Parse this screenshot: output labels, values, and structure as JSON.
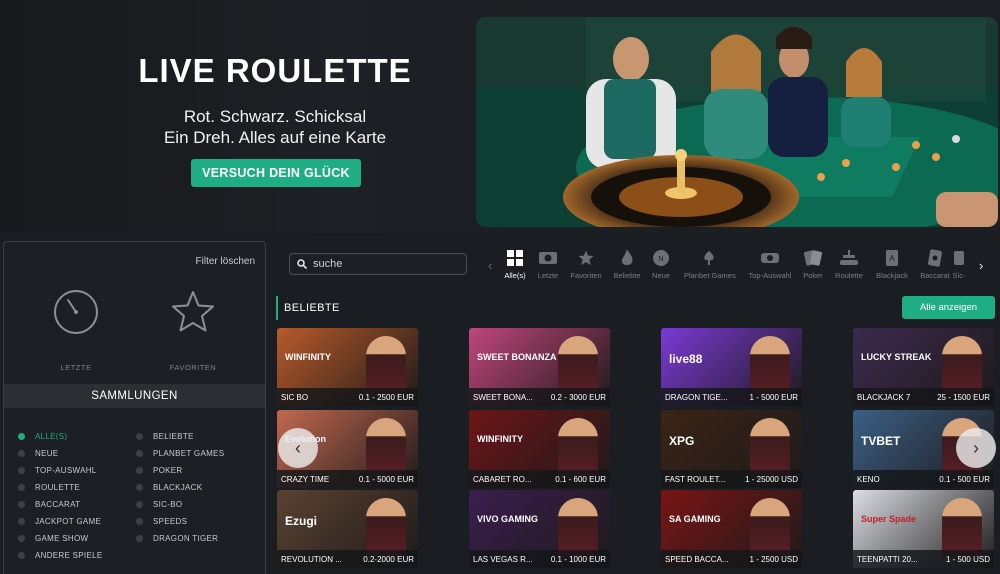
{
  "hero": {
    "title": "LIVE ROULETTE",
    "subtitle_line1": "Rot. Schwarz. Schicksal",
    "subtitle_line2": "Ein Dreh. Alles auf eine Karte",
    "cta_label": "VERSUCH DEIN GLÜCK"
  },
  "sidebar": {
    "filter_clear": "Filter löschen",
    "recent_label": "LETZTE",
    "favorites_label": "FAVORITEN",
    "collections_title": "SAMMLUNGEN",
    "collections": [
      {
        "label": "ALLE(S)",
        "active": true
      },
      {
        "label": "NEUE"
      },
      {
        "label": "TOP-AUSWAHL"
      },
      {
        "label": "ROULETTE"
      },
      {
        "label": "BACCARAT"
      },
      {
        "label": "JACKPOT GAME"
      },
      {
        "label": "GAME SHOW"
      },
      {
        "label": "ANDERE SPIELE"
      },
      {
        "label": "BELIEBTE"
      },
      {
        "label": "PLANBET GAMES"
      },
      {
        "label": "POKER"
      },
      {
        "label": "BLACKJACK"
      },
      {
        "label": "SIC-BO"
      },
      {
        "label": "SPEEDS"
      },
      {
        "label": "DRAGON TIGER"
      }
    ]
  },
  "search": {
    "placeholder": "suche"
  },
  "categories": [
    {
      "label": "Alle(s)",
      "icon": "grid-icon",
      "active": true
    },
    {
      "label": "Letzte",
      "icon": "recent-icon"
    },
    {
      "label": "Favoriten",
      "icon": "star-icon"
    },
    {
      "label": "Beliebte",
      "icon": "fire-icon"
    },
    {
      "label": "Neue",
      "icon": "badge-icon"
    },
    {
      "label": "Planbet Games",
      "icon": "cards-icon"
    },
    {
      "label": "Top-Auswahl",
      "icon": "chips-icon"
    },
    {
      "label": "Poker",
      "icon": "poker-icon"
    },
    {
      "label": "Roulette",
      "icon": "roulette-icon"
    },
    {
      "label": "Blackjack",
      "icon": "blackjack-icon"
    },
    {
      "label": "Baccarat",
      "icon": "baccarat-icon"
    },
    {
      "label": "Sic-",
      "icon": "dice-icon"
    }
  ],
  "section": {
    "title": "BELIEBTE",
    "show_all": "Alle anzeigen"
  },
  "games": [
    {
      "name": "SIC BO",
      "limit": "0.1 - 2500 EUR",
      "logo": "WINFINITY",
      "bg": "#b85a2a"
    },
    {
      "name": "SWEET BONA...",
      "limit": "0.2 - 3000 EUR",
      "logo": "SWEET BONANZA",
      "bg": "#c0467c"
    },
    {
      "name": "DRAGON TIGE...",
      "limit": "1 - 5000 EUR",
      "logo": "live88",
      "bg": "#7a3ad6"
    },
    {
      "name": "BLACKJACK 7",
      "limit": "25 - 1500 EUR",
      "logo": "LUCKY STREAK",
      "bg": "#3b2a4e"
    },
    {
      "name": "CRAZY TIME",
      "limit": "0.1 - 5000 EUR",
      "logo": "Evolution",
      "bg": "#c2684f"
    },
    {
      "name": "CABARET RO...",
      "limit": "0.1 - 600 EUR",
      "logo": "WINFINITY",
      "bg": "#6d1418"
    },
    {
      "name": "FAST ROULET...",
      "limit": "1 - 25000 USD",
      "logo": "XPG",
      "bg": "#3a2416"
    },
    {
      "name": "KENO",
      "limit": "0.1 - 500 EUR",
      "logo": "TVBET",
      "bg": "#3b5f86"
    },
    {
      "name": "REVOLUTION ...",
      "limit": "0.2-2000 EUR",
      "logo": "Ezugi",
      "bg": "#5a4232"
    },
    {
      "name": "LAS VEGAS R...",
      "limit": "0.1 - 1000 EUR",
      "logo": "VIVO GAMING",
      "bg": "#3a1e4e"
    },
    {
      "name": "SPEED BACCA...",
      "limit": "1 - 2500 USD",
      "logo": "SA GAMING",
      "bg": "#7a1414"
    },
    {
      "name": "TEENPATTI 20...",
      "limit": "1 - 500 USD",
      "logo": "Super Spade",
      "bg": "#dadde3"
    }
  ]
}
